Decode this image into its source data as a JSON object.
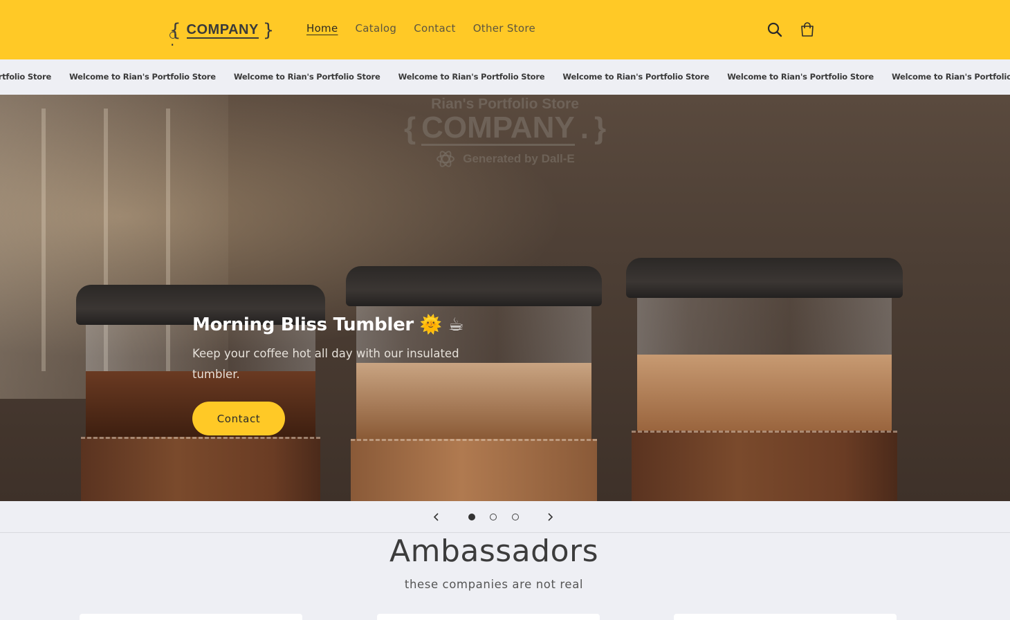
{
  "header": {
    "logo": {
      "open_brace": "{",
      "word": "COMPANY",
      "dot": ".",
      "close_brace": "}"
    },
    "nav": [
      {
        "label": "Home",
        "active": true
      },
      {
        "label": "Catalog",
        "active": false
      },
      {
        "label": "Contact",
        "active": false
      },
      {
        "label": "Other Store",
        "active": false
      }
    ],
    "icons": {
      "search": "search-icon",
      "cart": "cart-icon"
    },
    "colors": {
      "background": "#ffc926",
      "text": "#3a3a3a"
    }
  },
  "announcement": {
    "first_fragment": "Rian's Portfolio Store",
    "message": "Welcome to Rian's Portfolio Store",
    "last_fragment": "Welcome to Rian's Portfolio"
  },
  "hero": {
    "overlay": {
      "store_name": "Rian's Portfolio Store",
      "open_brace": "{",
      "word": "COMPANY",
      "dot": ".",
      "close_brace": "}",
      "generated_by": "Generated by Dall-E"
    },
    "title": "Morning Bliss Tumbler 🌞 ☕",
    "subtitle": "Keep your coffee hot all day with our insulated tumbler.",
    "button_label": "Contact",
    "accent_color": "#ffc926"
  },
  "slider": {
    "slides": 3,
    "active_index": 0
  },
  "ambassadors": {
    "title": "Ambassadors",
    "subtitle": "these companies are not real"
  }
}
